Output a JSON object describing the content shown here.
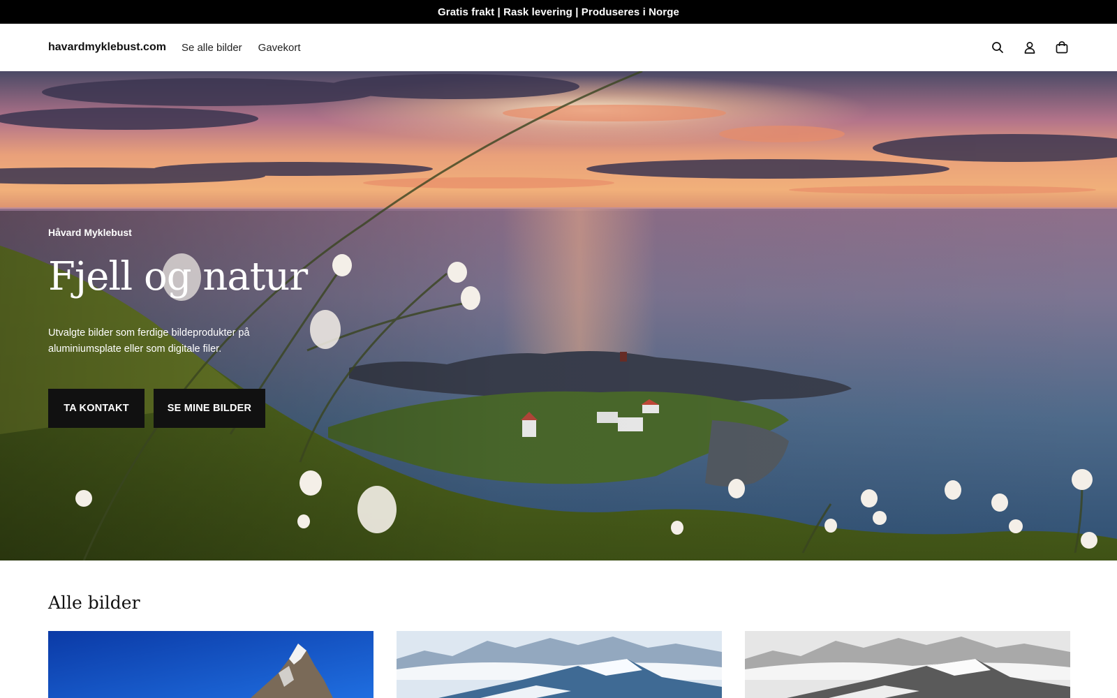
{
  "announcement": {
    "text": "Gratis frakt | Rask levering | Produseres i Norge"
  },
  "header": {
    "logo": "havardmyklebust.com",
    "nav": [
      {
        "label": "Se alle bilder"
      },
      {
        "label": "Gavekort"
      }
    ],
    "icons": [
      "search-icon",
      "account-icon",
      "cart-icon"
    ]
  },
  "hero": {
    "eyebrow": "Håvard Myklebust",
    "title": "Fjell og natur",
    "description": "Utvalgte bilder som ferdige bildeprodukter på aluminiumsplate eller som digitale filer.",
    "buttons": [
      {
        "label": "TA KONTAKT"
      },
      {
        "label": "SE MINE BILDER"
      }
    ]
  },
  "collection": {
    "title": "Alle bilder"
  },
  "colors": {
    "announcement_bg": "#000000",
    "button_bg": "#111111",
    "text": "#111111"
  }
}
